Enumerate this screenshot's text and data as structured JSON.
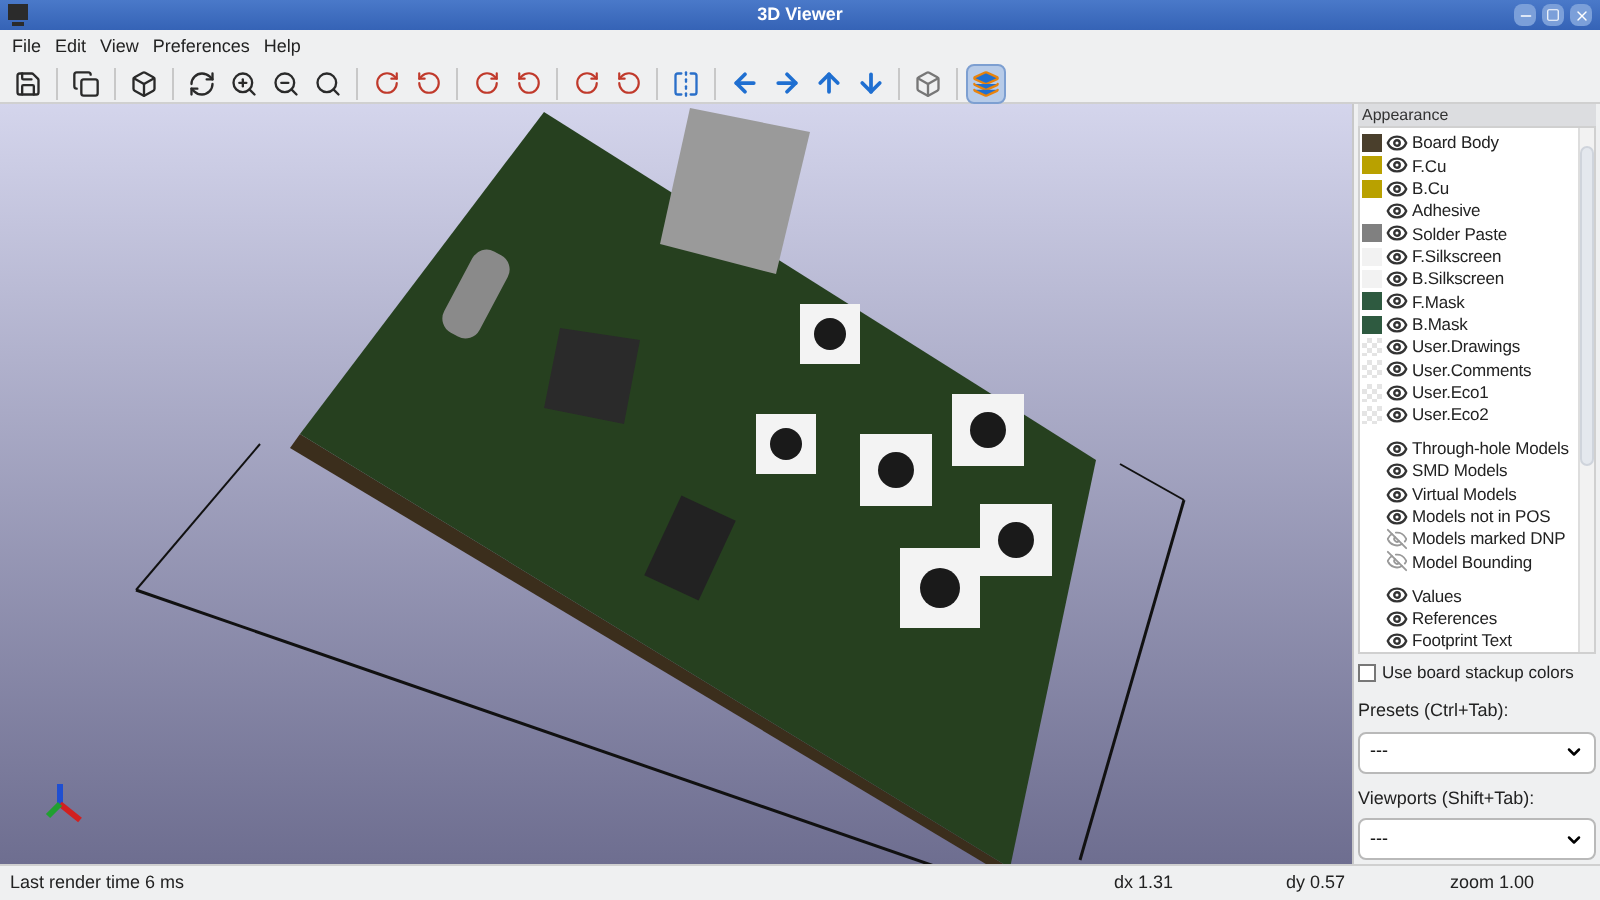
{
  "window": {
    "title": "3D Viewer"
  },
  "menu": [
    "File",
    "Edit",
    "View",
    "Preferences",
    "Help"
  ],
  "toolbar": {
    "render_toggle_on": true
  },
  "appearance": {
    "title": "Appearance",
    "layers": [
      {
        "label": "Board Body",
        "kind": "swatch",
        "color": "#4a3f2c",
        "visible": true
      },
      {
        "label": "F.Cu",
        "kind": "swatch",
        "color": "#b9a100",
        "visible": true
      },
      {
        "label": "B.Cu",
        "kind": "swatch",
        "color": "#b9a100",
        "visible": true
      },
      {
        "label": "Adhesive",
        "kind": "none",
        "visible": true
      },
      {
        "label": "Solder Paste",
        "kind": "swatch",
        "color": "#808080",
        "visible": true
      },
      {
        "label": "F.Silkscreen",
        "kind": "swatch",
        "color": "#f2f2f2",
        "visible": true
      },
      {
        "label": "B.Silkscreen",
        "kind": "swatch",
        "color": "#f2f2f2",
        "visible": true
      },
      {
        "label": "F.Mask",
        "kind": "swatch",
        "color": "#2e5a40",
        "visible": true
      },
      {
        "label": "B.Mask",
        "kind": "swatch",
        "color": "#2e5a40",
        "visible": true
      },
      {
        "label": "User.Drawings",
        "kind": "checker",
        "visible": true
      },
      {
        "label": "User.Comments",
        "kind": "checker",
        "visible": true
      },
      {
        "label": "User.Eco1",
        "kind": "checker",
        "visible": true
      },
      {
        "label": "User.Eco2",
        "kind": "checker",
        "visible": true
      }
    ],
    "models": [
      {
        "label": "Through-hole Models",
        "visible": true
      },
      {
        "label": "SMD Models",
        "visible": true
      },
      {
        "label": "Virtual Models",
        "visible": true
      },
      {
        "label": "Models not in POS",
        "visible": true
      },
      {
        "label": "Models marked DNP",
        "visible": false
      },
      {
        "label": "Model Bounding",
        "visible": false
      }
    ],
    "texts": [
      {
        "label": "Values",
        "visible": true
      },
      {
        "label": "References",
        "visible": true
      },
      {
        "label": "Footprint Text",
        "visible": true
      }
    ],
    "stackup": {
      "label": "Use board stackup colors",
      "checked": false
    },
    "presets": {
      "label": "Presets (Ctrl+Tab):",
      "value": "---"
    },
    "viewports": {
      "label": "Viewports (Shift+Tab):",
      "value": "---"
    }
  },
  "status_bar": {
    "message": "Last render time 6 ms",
    "dx": "dx 1.31",
    "dy": "dy 0.57",
    "zoom": "zoom 1.00"
  }
}
